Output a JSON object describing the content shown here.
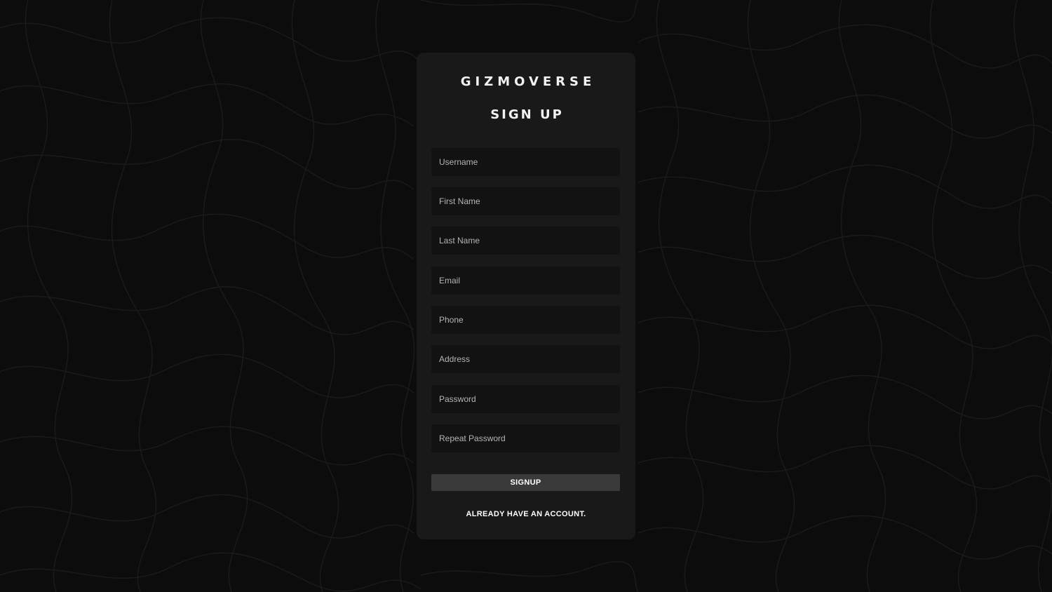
{
  "brand": "GIZMOVERSE",
  "title": "SIGN UP",
  "fields": [
    {
      "placeholder": "Username",
      "value": ""
    },
    {
      "placeholder": "First Name",
      "value": ""
    },
    {
      "placeholder": "Last Name",
      "value": ""
    },
    {
      "placeholder": "Email",
      "value": ""
    },
    {
      "placeholder": "Phone",
      "value": ""
    },
    {
      "placeholder": "Address",
      "value": ""
    },
    {
      "placeholder": "Password",
      "value": ""
    },
    {
      "placeholder": "Repeat Password",
      "value": ""
    }
  ],
  "signup_label": "SIGNUP",
  "login_link": "ALREADY HAVE AN ACCOUNT.",
  "colors": {
    "background": "#0c0c0c",
    "card": "#1e1e1e",
    "input": "#121212",
    "button": "#3a3a3a",
    "text": "#ffffff"
  }
}
